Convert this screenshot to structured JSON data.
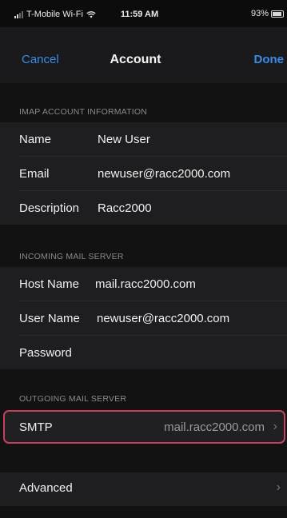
{
  "status_bar": {
    "carrier": "T-Mobile Wi-Fi",
    "time": "11:59 AM",
    "battery": "93%",
    "battery_level": 0.93
  },
  "nav": {
    "cancel_label": "Cancel",
    "title": "Account",
    "done_label": "Done"
  },
  "imap_section": {
    "header": "IMAP ACCOUNT INFORMATION",
    "rows": [
      {
        "label": "Name",
        "value": "New User"
      },
      {
        "label": "Email",
        "value": "newuser@racc2000.com"
      },
      {
        "label": "Description",
        "value": "Racc2000"
      }
    ]
  },
  "incoming_section": {
    "header": "INCOMING MAIL SERVER",
    "rows": [
      {
        "label": "Host Name",
        "value": "mail.racc2000.com"
      },
      {
        "label": "User Name",
        "value": "newuser@racc2000.com"
      },
      {
        "label": "Password",
        "value": ""
      }
    ]
  },
  "outgoing_section": {
    "header": "OUTGOING MAIL SERVER",
    "smtp_label": "SMTP",
    "smtp_value": "mail.racc2000.com"
  },
  "advanced": {
    "label": "Advanced"
  },
  "icons": {
    "chevron": "chevron-right-icon",
    "wifi": "wifi-icon",
    "signal": "signal-icon",
    "battery": "battery-icon"
  },
  "colors": {
    "accent": "#3a8be8",
    "highlight_border": "#c2415c"
  }
}
